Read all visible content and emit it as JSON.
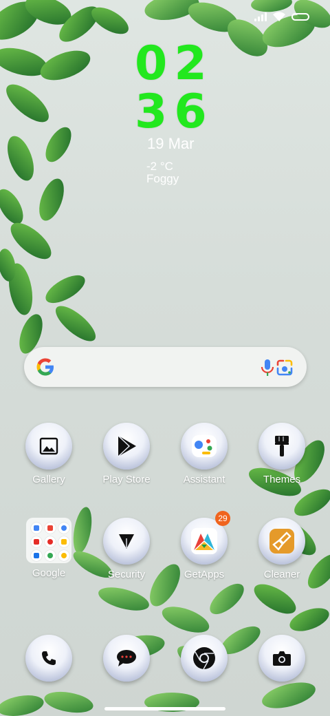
{
  "status_bar": {
    "signal_icon": "signal-icon",
    "wifi_icon": "wifi-icon",
    "battery_icon": "battery-icon"
  },
  "clock": {
    "hours": "02",
    "minutes": "36",
    "color": "#22e81e"
  },
  "date": "19 Mar",
  "weather": {
    "temperature": "-2 °C",
    "condition": "Foggy"
  },
  "search_bar": {
    "logo": "google-g-icon",
    "mic_icon": "mic-icon",
    "lens_icon": "lens-icon"
  },
  "apps_row1": [
    {
      "label": "Gallery",
      "icon": "gallery-icon"
    },
    {
      "label": "Play Store",
      "icon": "play-store-icon"
    },
    {
      "label": "Assistant",
      "icon": "assistant-icon"
    },
    {
      "label": "Themes",
      "icon": "brush-icon"
    }
  ],
  "apps_row2": [
    {
      "label": "Google",
      "icon": "folder-icon"
    },
    {
      "label": "Security",
      "icon": "security-icon"
    },
    {
      "label": "GetApps",
      "icon": "getapps-icon",
      "badge": "29"
    },
    {
      "label": "Cleaner",
      "icon": "cleaner-icon"
    }
  ],
  "dock": [
    {
      "icon": "phone-icon"
    },
    {
      "icon": "messages-icon"
    },
    {
      "icon": "chrome-icon"
    },
    {
      "icon": "camera-icon"
    }
  ],
  "colors": {
    "badge": "#f0641e",
    "label": "#ffffff"
  }
}
